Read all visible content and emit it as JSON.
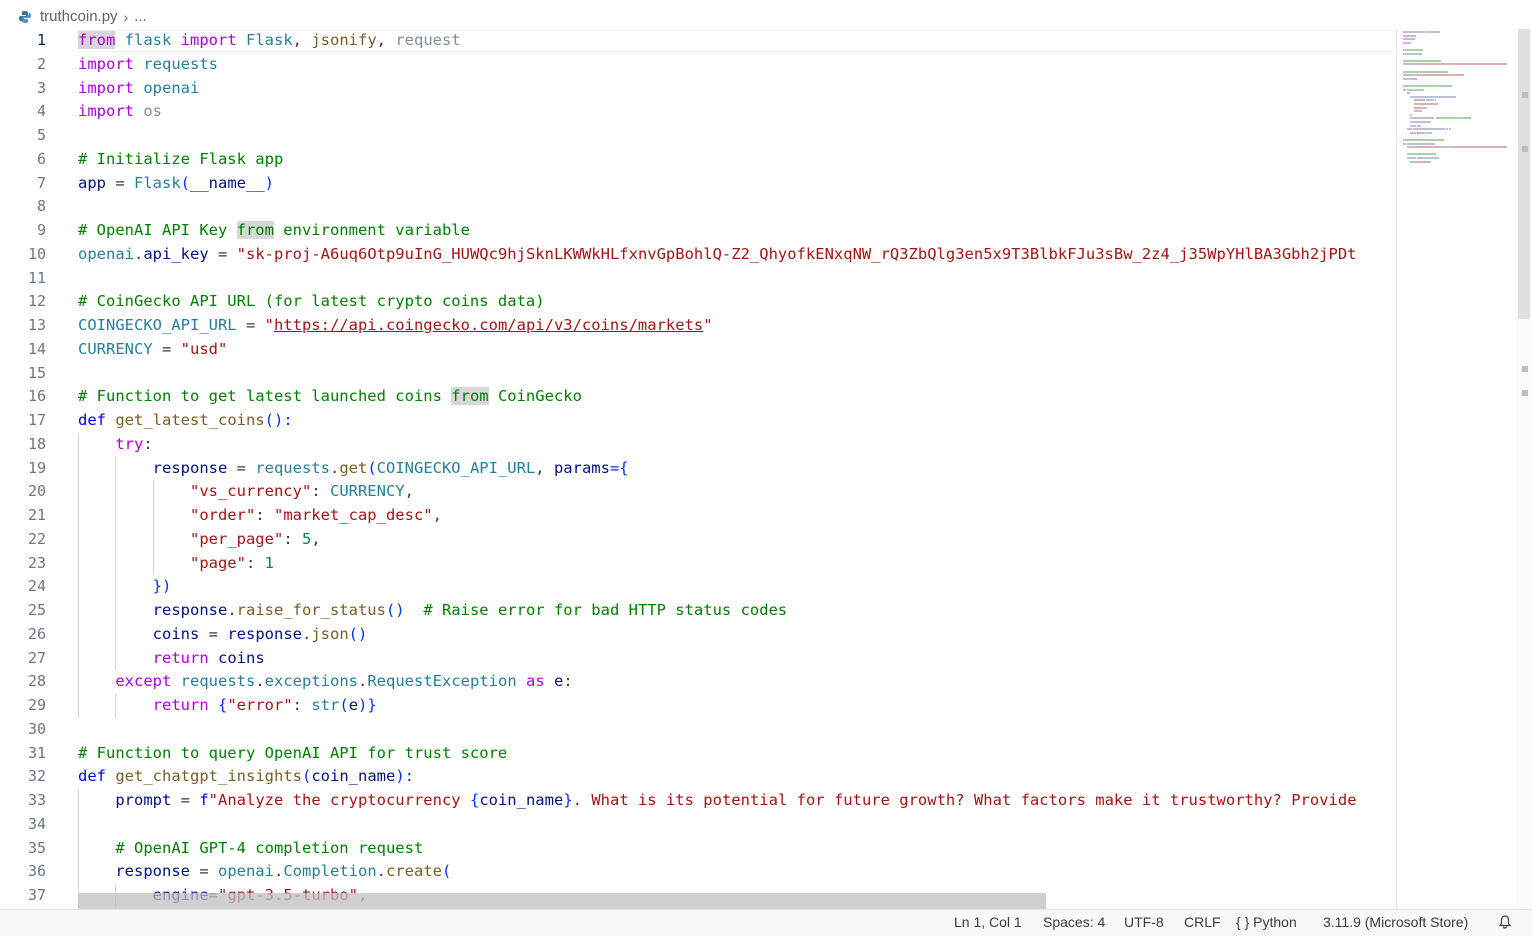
{
  "breadcrumb": {
    "file": "truthcoin.py",
    "more": "..."
  },
  "code_lines": [
    {
      "n": "1",
      "segs": [
        {
          "t": "from",
          "c": "kc wh"
        },
        {
          "t": " flask ",
          "c": "mod"
        },
        {
          "t": "import",
          "c": "kc"
        },
        {
          "t": " Flask",
          "c": "mod"
        },
        {
          "t": ", ",
          "c": ""
        },
        {
          "t": "jsonify",
          "c": "fn"
        },
        {
          "t": ", ",
          "c": ""
        },
        {
          "t": "request",
          "c": "dim"
        }
      ]
    },
    {
      "n": "2",
      "segs": [
        {
          "t": "import",
          "c": "kc"
        },
        {
          "t": " requests",
          "c": "mod"
        }
      ]
    },
    {
      "n": "3",
      "segs": [
        {
          "t": "import",
          "c": "kc"
        },
        {
          "t": " openai",
          "c": "mod"
        }
      ]
    },
    {
      "n": "4",
      "segs": [
        {
          "t": "import",
          "c": "kc"
        },
        {
          "t": " os",
          "c": "dim"
        }
      ]
    },
    {
      "n": "5",
      "segs": []
    },
    {
      "n": "6",
      "segs": [
        {
          "t": "# Initialize Flask app",
          "c": "cm"
        }
      ]
    },
    {
      "n": "7",
      "segs": [
        {
          "t": "app",
          "c": "vr"
        },
        {
          "t": " = ",
          "c": ""
        },
        {
          "t": "Flask",
          "c": "mod"
        },
        {
          "t": "(",
          "c": "br1"
        },
        {
          "t": "__name__",
          "c": "vr"
        },
        {
          "t": ")",
          "c": "br1"
        }
      ]
    },
    {
      "n": "8",
      "segs": []
    },
    {
      "n": "9",
      "segs": [
        {
          "t": "# OpenAI API Key ",
          "c": "cm"
        },
        {
          "t": "from",
          "c": "cm wh"
        },
        {
          "t": " environment variable",
          "c": "cm"
        }
      ]
    },
    {
      "n": "10",
      "segs": [
        {
          "t": "openai",
          "c": "mod"
        },
        {
          "t": ".",
          "c": ""
        },
        {
          "t": "api_key",
          "c": "vr"
        },
        {
          "t": " = ",
          "c": ""
        },
        {
          "t": "\"sk-proj-A6uq6Otp9uInG_HUWQc9hjSknLKWWkHLfxnvGpBohlQ-Z2_QhyofkENxqNW_rQ3ZbQlg3en5x9T3BlbkFJu3sBw_2z4_j35WpYHlBA3Gbh2jPDt",
          "c": "st"
        }
      ]
    },
    {
      "n": "11",
      "segs": []
    },
    {
      "n": "12",
      "segs": [
        {
          "t": "# CoinGecko API URL (for latest crypto coins data)",
          "c": "cm"
        }
      ]
    },
    {
      "n": "13",
      "segs": [
        {
          "t": "COINGECKO_API_URL",
          "c": "mod"
        },
        {
          "t": " = ",
          "c": ""
        },
        {
          "t": "\"",
          "c": "st"
        },
        {
          "t": "https://api.coingecko.com/api/v3/coins/markets",
          "c": "st link"
        },
        {
          "t": "\"",
          "c": "st"
        }
      ]
    },
    {
      "n": "14",
      "segs": [
        {
          "t": "CURRENCY",
          "c": "mod"
        },
        {
          "t": " = ",
          "c": ""
        },
        {
          "t": "\"usd\"",
          "c": "st"
        }
      ]
    },
    {
      "n": "15",
      "segs": []
    },
    {
      "n": "16",
      "segs": [
        {
          "t": "# Function to get latest launched coins ",
          "c": "cm"
        },
        {
          "t": "from",
          "c": "cm wh"
        },
        {
          "t": " CoinGecko",
          "c": "cm"
        }
      ]
    },
    {
      "n": "17",
      "segs": [
        {
          "t": "def",
          "c": "kw"
        },
        {
          "t": " ",
          "c": ""
        },
        {
          "t": "get_latest_coins",
          "c": "fn"
        },
        {
          "t": "():",
          "c": "br1"
        }
      ]
    },
    {
      "n": "18",
      "indent": 1,
      "segs": [
        {
          "t": "    ",
          "c": ""
        },
        {
          "t": "try",
          "c": "kc"
        },
        {
          "t": ":",
          "c": ""
        }
      ]
    },
    {
      "n": "19",
      "indent": 2,
      "segs": [
        {
          "t": "        ",
          "c": ""
        },
        {
          "t": "response",
          "c": "vr"
        },
        {
          "t": " = ",
          "c": ""
        },
        {
          "t": "requests",
          "c": "mod"
        },
        {
          "t": ".",
          "c": ""
        },
        {
          "t": "get",
          "c": "fn"
        },
        {
          "t": "(",
          "c": "br1"
        },
        {
          "t": "COINGECKO_API_URL",
          "c": "mod"
        },
        {
          "t": ", ",
          "c": ""
        },
        {
          "t": "params",
          "c": "vr"
        },
        {
          "t": "={",
          "c": "br1"
        }
      ]
    },
    {
      "n": "20",
      "indent": 3,
      "segs": [
        {
          "t": "            ",
          "c": ""
        },
        {
          "t": "\"vs_currency\"",
          "c": "st"
        },
        {
          "t": ": ",
          "c": ""
        },
        {
          "t": "CURRENCY",
          "c": "mod"
        },
        {
          "t": ",",
          "c": ""
        }
      ]
    },
    {
      "n": "21",
      "indent": 3,
      "segs": [
        {
          "t": "            ",
          "c": ""
        },
        {
          "t": "\"order\"",
          "c": "st"
        },
        {
          "t": ": ",
          "c": ""
        },
        {
          "t": "\"market_cap_desc\"",
          "c": "st"
        },
        {
          "t": ",",
          "c": ""
        }
      ]
    },
    {
      "n": "22",
      "indent": 3,
      "segs": [
        {
          "t": "            ",
          "c": ""
        },
        {
          "t": "\"per_page\"",
          "c": "st"
        },
        {
          "t": ": ",
          "c": ""
        },
        {
          "t": "5",
          "c": "nu"
        },
        {
          "t": ",",
          "c": ""
        }
      ]
    },
    {
      "n": "23",
      "indent": 3,
      "segs": [
        {
          "t": "            ",
          "c": ""
        },
        {
          "t": "\"page\"",
          "c": "st"
        },
        {
          "t": ": ",
          "c": ""
        },
        {
          "t": "1",
          "c": "nu"
        }
      ]
    },
    {
      "n": "24",
      "indent": 2,
      "segs": [
        {
          "t": "        ",
          "c": ""
        },
        {
          "t": "})",
          "c": "br1"
        }
      ]
    },
    {
      "n": "25",
      "indent": 2,
      "segs": [
        {
          "t": "        ",
          "c": ""
        },
        {
          "t": "response",
          "c": "vr"
        },
        {
          "t": ".",
          "c": ""
        },
        {
          "t": "raise_for_status",
          "c": "fn"
        },
        {
          "t": "()",
          "c": "br1"
        },
        {
          "t": "  ",
          "c": ""
        },
        {
          "t": "# Raise error for bad HTTP status codes",
          "c": "cm"
        }
      ]
    },
    {
      "n": "26",
      "indent": 2,
      "segs": [
        {
          "t": "        ",
          "c": ""
        },
        {
          "t": "coins",
          "c": "vr"
        },
        {
          "t": " = ",
          "c": ""
        },
        {
          "t": "response",
          "c": "vr"
        },
        {
          "t": ".",
          "c": ""
        },
        {
          "t": "json",
          "c": "fn"
        },
        {
          "t": "()",
          "c": "br1"
        }
      ]
    },
    {
      "n": "27",
      "indent": 2,
      "segs": [
        {
          "t": "        ",
          "c": ""
        },
        {
          "t": "return",
          "c": "kc"
        },
        {
          "t": " ",
          "c": ""
        },
        {
          "t": "coins",
          "c": "vr"
        }
      ]
    },
    {
      "n": "28",
      "indent": 1,
      "segs": [
        {
          "t": "    ",
          "c": ""
        },
        {
          "t": "except",
          "c": "kc"
        },
        {
          "t": " ",
          "c": ""
        },
        {
          "t": "requests",
          "c": "mod"
        },
        {
          "t": ".",
          "c": ""
        },
        {
          "t": "exceptions",
          "c": "mod"
        },
        {
          "t": ".",
          "c": ""
        },
        {
          "t": "RequestException",
          "c": "mod"
        },
        {
          "t": " ",
          "c": ""
        },
        {
          "t": "as",
          "c": "kc"
        },
        {
          "t": " ",
          "c": ""
        },
        {
          "t": "e",
          "c": "vr"
        },
        {
          "t": ":",
          "c": ""
        }
      ]
    },
    {
      "n": "29",
      "indent": 2,
      "segs": [
        {
          "t": "        ",
          "c": ""
        },
        {
          "t": "return",
          "c": "kc"
        },
        {
          "t": " ",
          "c": ""
        },
        {
          "t": "{",
          "c": "br1"
        },
        {
          "t": "\"error\"",
          "c": "st"
        },
        {
          "t": ": ",
          "c": ""
        },
        {
          "t": "str",
          "c": "mod"
        },
        {
          "t": "(",
          "c": "br1"
        },
        {
          "t": "e",
          "c": "vr"
        },
        {
          "t": ")}",
          "c": "br1"
        }
      ]
    },
    {
      "n": "30",
      "segs": []
    },
    {
      "n": "31",
      "segs": [
        {
          "t": "# Function to query OpenAI API for trust score",
          "c": "cm"
        }
      ]
    },
    {
      "n": "32",
      "segs": [
        {
          "t": "def",
          "c": "kw"
        },
        {
          "t": " ",
          "c": ""
        },
        {
          "t": "get_chatgpt_insights",
          "c": "fn"
        },
        {
          "t": "(",
          "c": "br1"
        },
        {
          "t": "coin_name",
          "c": "vr"
        },
        {
          "t": "):",
          "c": "br1"
        }
      ]
    },
    {
      "n": "33",
      "indent": 1,
      "segs": [
        {
          "t": "    ",
          "c": ""
        },
        {
          "t": "prompt",
          "c": "vr"
        },
        {
          "t": " = ",
          "c": ""
        },
        {
          "t": "f",
          "c": "kw"
        },
        {
          "t": "\"Analyze the cryptocurrency ",
          "c": "st"
        },
        {
          "t": "{",
          "c": "br1"
        },
        {
          "t": "coin_name",
          "c": "vr"
        },
        {
          "t": "}",
          "c": "br1"
        },
        {
          "t": ". What is its potential for future growth? What factors make it trustworthy? Provide",
          "c": "st"
        }
      ]
    },
    {
      "n": "34",
      "indent": 1,
      "segs": []
    },
    {
      "n": "35",
      "indent": 1,
      "segs": [
        {
          "t": "    ",
          "c": ""
        },
        {
          "t": "# OpenAI GPT-4 completion request",
          "c": "cm"
        }
      ]
    },
    {
      "n": "36",
      "indent": 1,
      "segs": [
        {
          "t": "    ",
          "c": ""
        },
        {
          "t": "response",
          "c": "vr"
        },
        {
          "t": " = ",
          "c": ""
        },
        {
          "t": "openai",
          "c": "mod"
        },
        {
          "t": ".",
          "c": ""
        },
        {
          "t": "Completion",
          "c": "mod"
        },
        {
          "t": ".",
          "c": ""
        },
        {
          "t": "create",
          "c": "fn"
        },
        {
          "t": "(",
          "c": "br1"
        }
      ]
    },
    {
      "n": "37",
      "indent": 2,
      "segs": [
        {
          "t": "        ",
          "c": ""
        },
        {
          "t": "engine",
          "c": "vr"
        },
        {
          "t": "=",
          "c": ""
        },
        {
          "t": "\"gpt-3.5-turbo\"",
          "c": "st"
        },
        {
          "t": ",",
          "c": ""
        }
      ]
    }
  ],
  "status_bar": {
    "position": "Ln 1, Col 1",
    "spaces": "Spaces: 4",
    "encoding": "UTF-8",
    "eol": "CRLF",
    "language_icon": "{ }",
    "language": "Python",
    "interpreter": "3.11.9 (Microsoft Store)"
  },
  "icons": {
    "file_icon": "python-file-icon",
    "bell": "bell-icon",
    "chevron": "chevron-right-icon"
  }
}
